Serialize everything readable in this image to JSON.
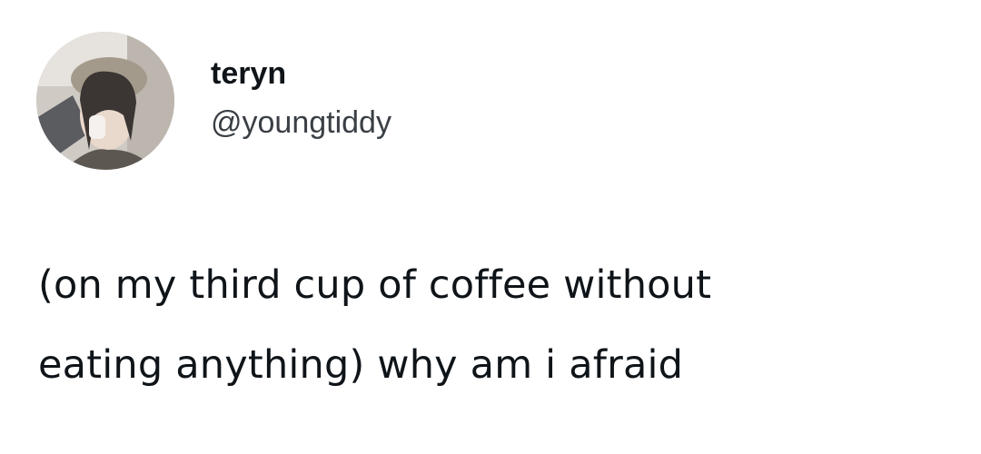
{
  "tweet": {
    "author": {
      "display_name": "teryn",
      "handle": "@youngtiddy",
      "avatar_icon": "profile-photo"
    },
    "text_lines": [
      "(on my third cup of coffee without",
      "eating anything) why am i afraid"
    ]
  },
  "colors": {
    "background": "#ffffff",
    "text": "#0f1419",
    "handle": "#3a3f45"
  }
}
